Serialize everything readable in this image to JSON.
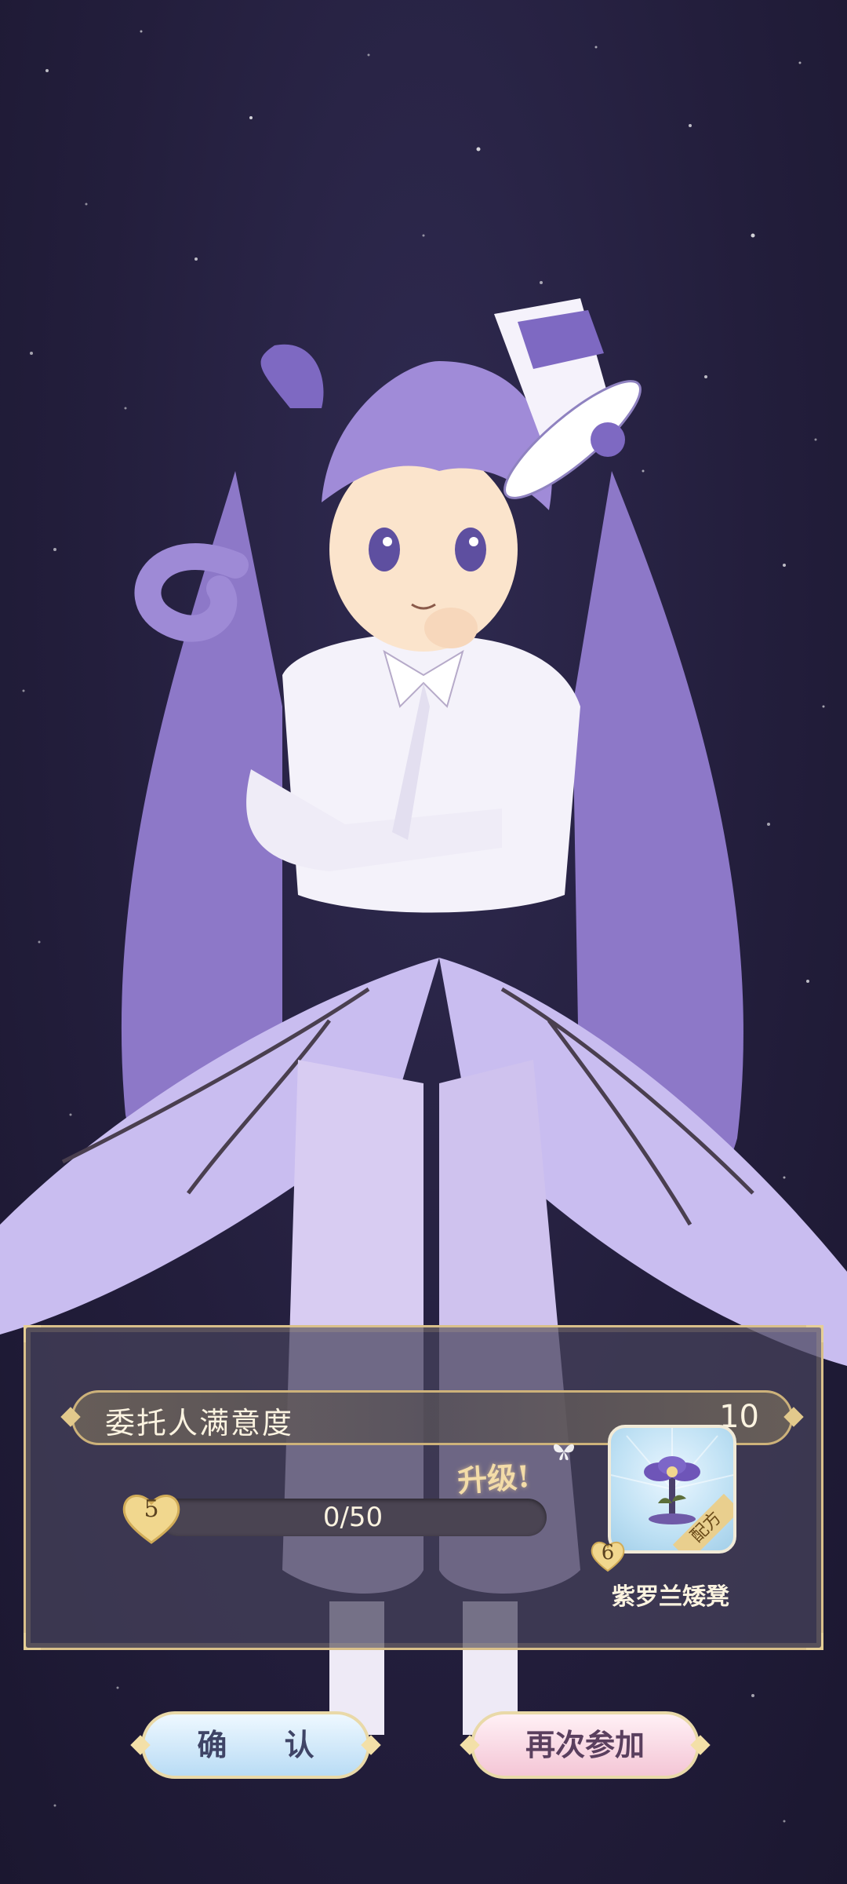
{
  "panel": {
    "satisfaction_label": "委托人满意度",
    "satisfaction_value": "10",
    "level_up_text": "升级!",
    "level": "5",
    "xp_text": "0/50",
    "xp_fraction": 0,
    "reward": {
      "tag": "配方",
      "level": "6",
      "name": "紫罗兰矮凳"
    }
  },
  "buttons": {
    "confirm": "确 认",
    "again": "再次参加"
  },
  "colors": {
    "background": "#231e3c",
    "panel_border": "#d9c08a",
    "confirm_button": "#b9dcf5",
    "again_button": "#f4c6d6",
    "character_purple": "#9e8ad6"
  }
}
